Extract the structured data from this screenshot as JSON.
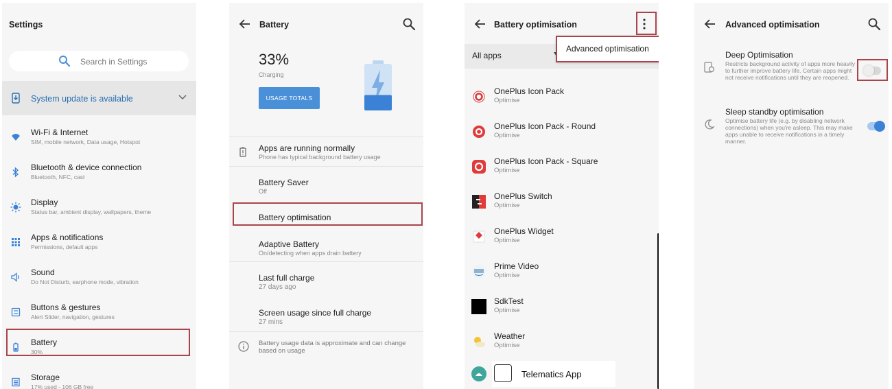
{
  "settings": {
    "title": "Settings",
    "search_placeholder": "Search in Settings",
    "update_banner": "System update is available",
    "items": [
      {
        "icon": "wifi-icon",
        "title": "Wi-Fi & Internet",
        "subtitle": "SIM, mobile network, Data usage, Hotspot"
      },
      {
        "icon": "bluetooth-icon",
        "title": "Bluetooth & device connection",
        "subtitle": "Bluetooth, NFC, cast"
      },
      {
        "icon": "display-icon",
        "title": "Display",
        "subtitle": "Status bar, ambient display, wallpapers, theme"
      },
      {
        "icon": "apps-grid-icon",
        "title": "Apps & notifications",
        "subtitle": "Permissions, default apps"
      },
      {
        "icon": "sound-icon",
        "title": "Sound",
        "subtitle": "Do Not Disturb, earphone mode, vibration"
      },
      {
        "icon": "buttons-icon",
        "title": "Buttons & gestures",
        "subtitle": "Alert Slider, navigation, gestures"
      },
      {
        "icon": "battery-icon",
        "title": "Battery",
        "subtitle": "30%"
      },
      {
        "icon": "storage-icon",
        "title": "Storage",
        "subtitle": "17% used - 106 GB free"
      }
    ]
  },
  "battery": {
    "title": "Battery",
    "percent": "33%",
    "status": "Charging",
    "usage_button": "USAGE TOTALS",
    "level": 0.33,
    "items": [
      {
        "title": "Apps are running normally",
        "subtitle": "Phone has typical background battery usage"
      },
      {
        "title": "Battery Saver",
        "subtitle": "Off"
      },
      {
        "title": "Battery optimisation",
        "subtitle": ""
      },
      {
        "title": "Adaptive Battery",
        "subtitle": "On/detecting when apps drain battery"
      },
      {
        "title": "Last full charge",
        "subtitle": "27 days ago"
      },
      {
        "title": "Screen usage since full charge",
        "subtitle": "27 mins"
      }
    ],
    "footer_note": "Battery usage data is approximate and can change based on usage"
  },
  "optimisation": {
    "title": "Battery optimisation",
    "filter": "All apps",
    "menu_item": "Advanced optimisation",
    "apps": [
      {
        "icon": "oneplus-icon-pack-icon",
        "name": "OnePlus Icon Pack",
        "status": "Optimise"
      },
      {
        "icon": "oneplus-icon-pack-round-icon",
        "name": "OnePlus Icon Pack - Round",
        "status": "Optimise"
      },
      {
        "icon": "oneplus-icon-pack-square-icon",
        "name": "OnePlus Icon Pack - Square",
        "status": "Optimise"
      },
      {
        "icon": "oneplus-switch-icon",
        "name": "OnePlus Switch",
        "status": "Optimise"
      },
      {
        "icon": "oneplus-widget-icon",
        "name": "OnePlus Widget",
        "status": "Optimise"
      },
      {
        "icon": "prime-video-icon",
        "name": "Prime Video",
        "status": "Optimise"
      },
      {
        "icon": "sdktest-icon",
        "name": "SdkTest",
        "status": "Optimise"
      },
      {
        "icon": "weather-icon",
        "name": "Weather",
        "status": "Optimise"
      }
    ],
    "telematics": "Telematics App"
  },
  "advanced": {
    "title": "Advanced optimisation",
    "items": [
      {
        "title": "Deep Optimisation",
        "description": "Restricts background activity of apps more heavily to further improve battery life. Certain apps might not receive notifications until they are reopened.",
        "enabled": false
      },
      {
        "title": "Sleep standby optimisation",
        "description": "Optimise battery life (e.g. by disabling network connections) when you're asleep. This may make apps unable to receive notifications in a timely manner.",
        "enabled": true
      }
    ]
  },
  "colors": {
    "accent": "#2a6fb1",
    "button": "#4a90d9",
    "highlight": "#a9454a",
    "panel_bg": "#f6f6f6"
  }
}
